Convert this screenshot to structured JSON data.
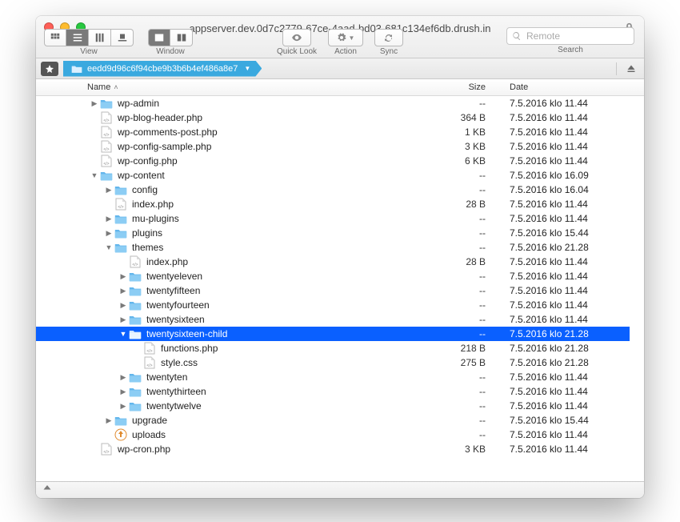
{
  "window": {
    "title": "appserver.dev.0d7c2779-67ce-4aad-bd03-681c134ef6db.drush.in"
  },
  "toolbar": {
    "view_label": "View",
    "window_label": "Window",
    "quicklook_label": "Quick Look",
    "action_label": "Action",
    "sync_label": "Sync",
    "search_label": "Search",
    "search_placeholder": "Remote"
  },
  "breadcrumb": {
    "path": "eedd9d96c6f94cbe9b3b6b4ef486a8e7"
  },
  "columns": {
    "name": "Name",
    "size": "Size",
    "date": "Date"
  },
  "rows": [
    {
      "depth": 1,
      "disclosure": "right",
      "icon": "folder",
      "name": "wp-admin",
      "size": "--",
      "date": "7.5.2016 klo 11.44",
      "selected": false
    },
    {
      "depth": 1,
      "disclosure": "",
      "icon": "php",
      "name": "wp-blog-header.php",
      "size": "364 B",
      "date": "7.5.2016 klo 11.44",
      "selected": false
    },
    {
      "depth": 1,
      "disclosure": "",
      "icon": "php",
      "name": "wp-comments-post.php",
      "size": "1 KB",
      "date": "7.5.2016 klo 11.44",
      "selected": false
    },
    {
      "depth": 1,
      "disclosure": "",
      "icon": "php",
      "name": "wp-config-sample.php",
      "size": "3 KB",
      "date": "7.5.2016 klo 11.44",
      "selected": false
    },
    {
      "depth": 1,
      "disclosure": "",
      "icon": "php",
      "name": "wp-config.php",
      "size": "6 KB",
      "date": "7.5.2016 klo 11.44",
      "selected": false
    },
    {
      "depth": 1,
      "disclosure": "down",
      "icon": "folder",
      "name": "wp-content",
      "size": "--",
      "date": "7.5.2016 klo 16.09",
      "selected": false
    },
    {
      "depth": 2,
      "disclosure": "right",
      "icon": "folder",
      "name": "config",
      "size": "--",
      "date": "7.5.2016 klo 16.04",
      "selected": false
    },
    {
      "depth": 2,
      "disclosure": "",
      "icon": "php",
      "name": "index.php",
      "size": "28 B",
      "date": "7.5.2016 klo 11.44",
      "selected": false
    },
    {
      "depth": 2,
      "disclosure": "right",
      "icon": "folder",
      "name": "mu-plugins",
      "size": "--",
      "date": "7.5.2016 klo 11.44",
      "selected": false
    },
    {
      "depth": 2,
      "disclosure": "right",
      "icon": "folder",
      "name": "plugins",
      "size": "--",
      "date": "7.5.2016 klo 15.44",
      "selected": false
    },
    {
      "depth": 2,
      "disclosure": "down",
      "icon": "folder",
      "name": "themes",
      "size": "--",
      "date": "7.5.2016 klo 21.28",
      "selected": false
    },
    {
      "depth": 3,
      "disclosure": "",
      "icon": "php",
      "name": "index.php",
      "size": "28 B",
      "date": "7.5.2016 klo 11.44",
      "selected": false
    },
    {
      "depth": 3,
      "disclosure": "right",
      "icon": "folder",
      "name": "twentyeleven",
      "size": "--",
      "date": "7.5.2016 klo 11.44",
      "selected": false
    },
    {
      "depth": 3,
      "disclosure": "right",
      "icon": "folder",
      "name": "twentyfifteen",
      "size": "--",
      "date": "7.5.2016 klo 11.44",
      "selected": false
    },
    {
      "depth": 3,
      "disclosure": "right",
      "icon": "folder",
      "name": "twentyfourteen",
      "size": "--",
      "date": "7.5.2016 klo 11.44",
      "selected": false
    },
    {
      "depth": 3,
      "disclosure": "right",
      "icon": "folder",
      "name": "twentysixteen",
      "size": "--",
      "date": "7.5.2016 klo 11.44",
      "selected": false
    },
    {
      "depth": 3,
      "disclosure": "down",
      "icon": "folder",
      "name": "twentysixteen-child",
      "size": "--",
      "date": "7.5.2016 klo 21.28",
      "selected": true
    },
    {
      "depth": 4,
      "disclosure": "",
      "icon": "php",
      "name": "functions.php",
      "size": "218 B",
      "date": "7.5.2016 klo 21.28",
      "selected": false
    },
    {
      "depth": 4,
      "disclosure": "",
      "icon": "php",
      "name": "style.css",
      "size": "275 B",
      "date": "7.5.2016 klo 21.28",
      "selected": false
    },
    {
      "depth": 3,
      "disclosure": "right",
      "icon": "folder",
      "name": "twentyten",
      "size": "--",
      "date": "7.5.2016 klo 11.44",
      "selected": false
    },
    {
      "depth": 3,
      "disclosure": "right",
      "icon": "folder",
      "name": "twentythirteen",
      "size": "--",
      "date": "7.5.2016 klo 11.44",
      "selected": false
    },
    {
      "depth": 3,
      "disclosure": "right",
      "icon": "folder",
      "name": "twentytwelve",
      "size": "--",
      "date": "7.5.2016 klo 11.44",
      "selected": false
    },
    {
      "depth": 2,
      "disclosure": "right",
      "icon": "folder",
      "name": "upgrade",
      "size": "--",
      "date": "7.5.2016 klo 15.44",
      "selected": false
    },
    {
      "depth": 2,
      "disclosure": "",
      "icon": "uploads",
      "name": "uploads",
      "size": "--",
      "date": "7.5.2016 klo 11.44",
      "selected": false
    },
    {
      "depth": 1,
      "disclosure": "",
      "icon": "php",
      "name": "wp-cron.php",
      "size": "3 KB",
      "date": "7.5.2016 klo 11.44",
      "selected": false
    }
  ]
}
